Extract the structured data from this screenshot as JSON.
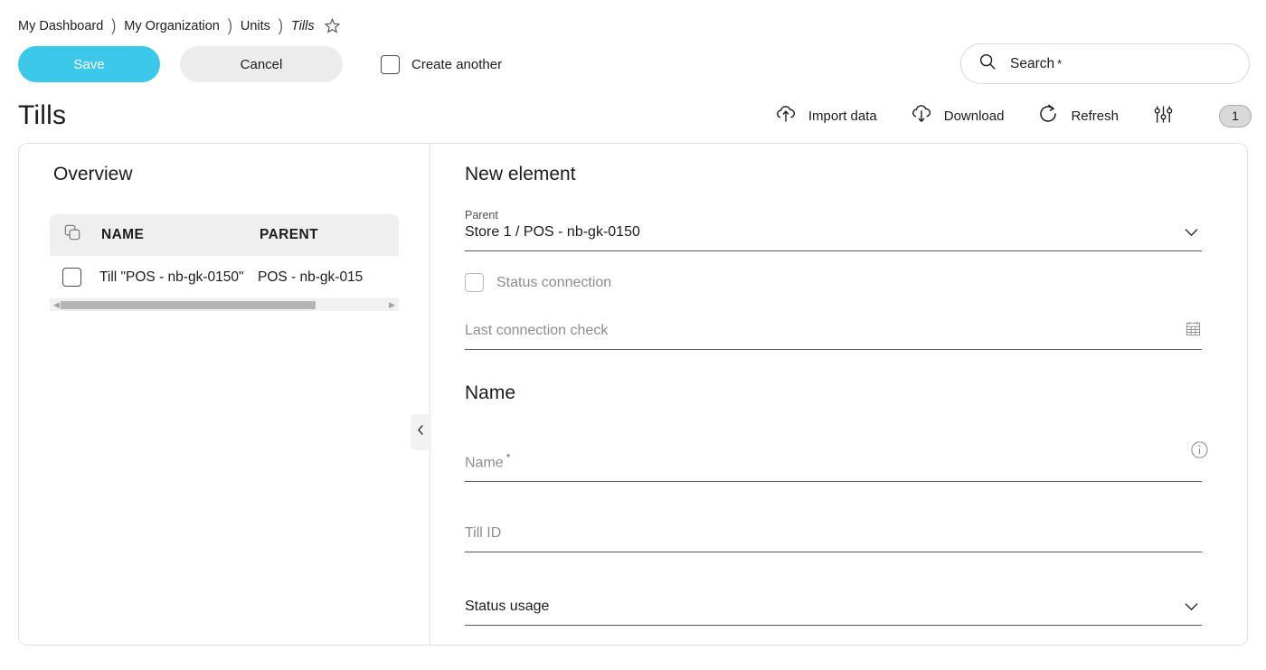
{
  "breadcrumb": {
    "items": [
      {
        "label": "My Dashboard",
        "current": false
      },
      {
        "label": "My Organization",
        "current": false
      },
      {
        "label": "Units",
        "current": false
      },
      {
        "label": "Tills",
        "current": true
      }
    ],
    "separator": ")",
    "favorite_icon": "star-icon"
  },
  "actionbar": {
    "save_label": "Save",
    "cancel_label": "Cancel",
    "create_another_label": "Create another",
    "create_another_checked": false
  },
  "search": {
    "icon": "search-icon",
    "placeholder": "Search",
    "asterisk": "*",
    "value": ""
  },
  "header": {
    "title": "Tills",
    "tools": [
      {
        "label": "Import data",
        "icon": "cloud-upload-icon"
      },
      {
        "label": "Download",
        "icon": "cloud-download-icon"
      },
      {
        "label": "Refresh",
        "icon": "refresh-icon"
      }
    ],
    "filter_icon": "sliders-filter-icon",
    "badge_count": "1"
  },
  "overview": {
    "title": "Overview",
    "header_icon": "duplicate-icon",
    "columns": [
      "NAME",
      "PARENT"
    ],
    "rows": [
      {
        "selected": false,
        "name": "Till \"POS - nb-gk-0150\"",
        "parent": "POS - nb-gk-015"
      }
    ],
    "collapse_icon": "chevron-left-icon"
  },
  "form": {
    "title": "New element",
    "parent": {
      "label": "Parent",
      "value": "Store 1 / POS - nb-gk-0150",
      "chevron_icon": "chevron-down-icon"
    },
    "status_connection": {
      "label": "Status connection",
      "checked": false,
      "disabled": true
    },
    "last_connection_check": {
      "placeholder": "Last connection check",
      "value": "",
      "calendar_icon": "calendar-icon"
    },
    "name_section": {
      "title": "Name",
      "info_icon": "info-icon"
    },
    "name_field": {
      "placeholder": "Name",
      "required_marker": "*",
      "value": ""
    },
    "till_id_field": {
      "placeholder": "Till ID",
      "value": ""
    },
    "status_usage": {
      "placeholder": "Status usage",
      "value": "",
      "chevron_icon": "chevron-down-icon"
    }
  },
  "colors": {
    "accent": "#3cc8ea",
    "cancel_bg": "#ececec",
    "table_header_bg": "#efefef",
    "panel_border": "#e2e2e2"
  }
}
